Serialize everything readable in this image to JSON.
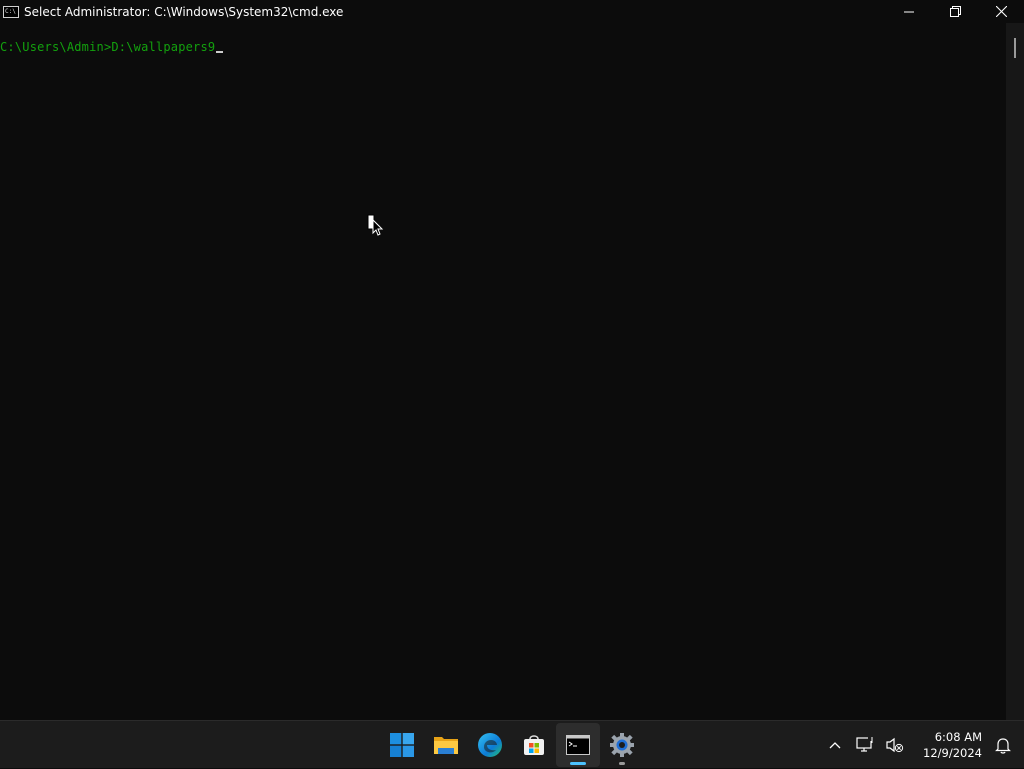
{
  "window": {
    "title": "Select Administrator: C:\\Windows\\System32\\cmd.exe",
    "icon_name": "cmd-icon",
    "icon_text": "C:\\",
    "controls": [
      "minimize-icon",
      "restore-icon",
      "close-icon"
    ]
  },
  "console": {
    "prompt": "C:\\Users\\Admin>",
    "typed_text": "D:\\wallpapers9",
    "prompt_color": "#13a10e",
    "background": "#0c0c0c"
  },
  "taskbar": {
    "apps": [
      {
        "name": "start",
        "icon": "windows-start-icon"
      },
      {
        "name": "file-explorer",
        "icon": "folder-icon"
      },
      {
        "name": "edge",
        "icon": "edge-icon"
      },
      {
        "name": "microsoft-store",
        "icon": "store-icon"
      },
      {
        "name": "command-prompt",
        "icon": "terminal-icon",
        "active": true
      },
      {
        "name": "settings",
        "icon": "gear-icon",
        "running": true
      }
    ],
    "tray": {
      "icons": [
        "chevron-up-icon",
        "network-icon",
        "volume-muted-icon"
      ],
      "time": "6:08 AM",
      "date": "12/9/2024",
      "notification_icon": "bell-icon"
    },
    "accent": "#4cc2ff"
  }
}
